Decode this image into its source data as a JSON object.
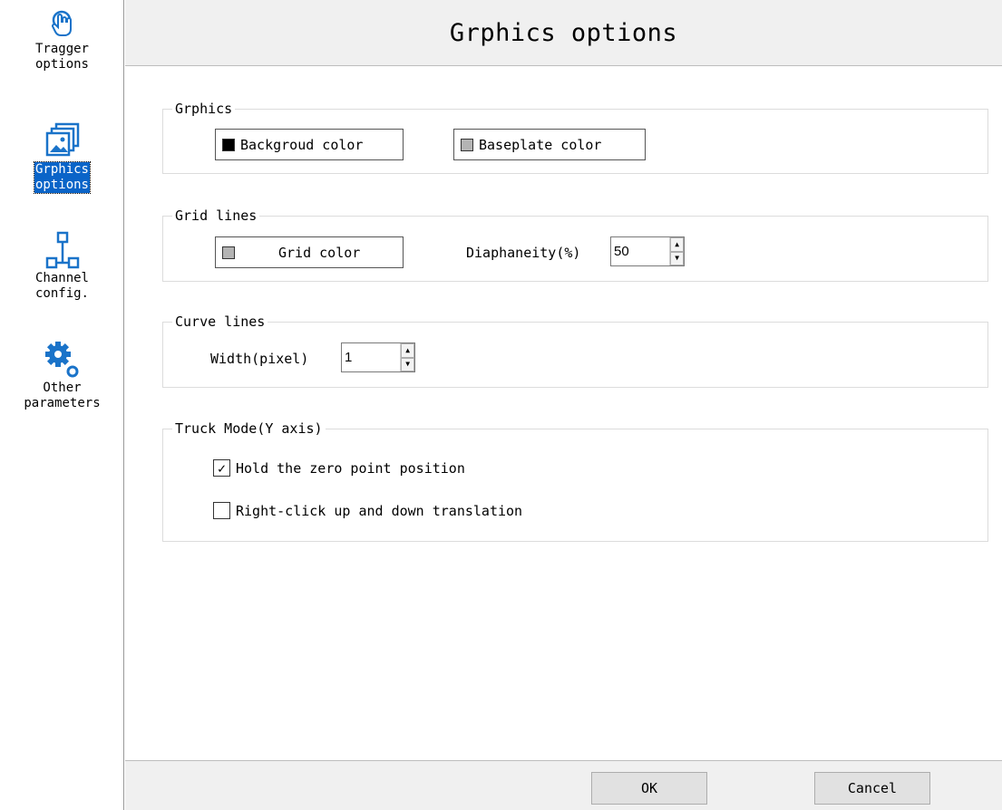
{
  "sidebar": {
    "items": [
      {
        "label": "Tragger\noptions",
        "icon": "touch-hand-icon",
        "active": false
      },
      {
        "label": "Grphics\noptions",
        "icon": "image-gallery-icon",
        "active": true
      },
      {
        "label": "Channel\nconfig.",
        "icon": "network-tree-icon",
        "active": false
      },
      {
        "label": "Other\nparameters",
        "icon": "gears-icon",
        "active": false
      }
    ]
  },
  "header": {
    "title": "Grphics options"
  },
  "graphics": {
    "legend": "Grphics",
    "background_label": "Backgroud color",
    "background_color": "#000000",
    "baseplate_label": "Baseplate color",
    "baseplate_color": "#b4b4b4"
  },
  "grid": {
    "legend": "Grid lines",
    "grid_color_label": "Grid color",
    "grid_color": "#b4b4b4",
    "diaphaneity_label": "Diaphaneity(%)",
    "diaphaneity_value": "50"
  },
  "curve": {
    "legend": "Curve lines",
    "width_label": "Width(pixel)",
    "width_value": "1"
  },
  "truck": {
    "legend": "Truck Mode(Y axis)",
    "hold_zero_label": "Hold the zero point position",
    "hold_zero_checked": true,
    "right_click_label": "Right-click up and down translation",
    "right_click_checked": false
  },
  "footer": {
    "ok_label": "OK",
    "cancel_label": "Cancel"
  }
}
